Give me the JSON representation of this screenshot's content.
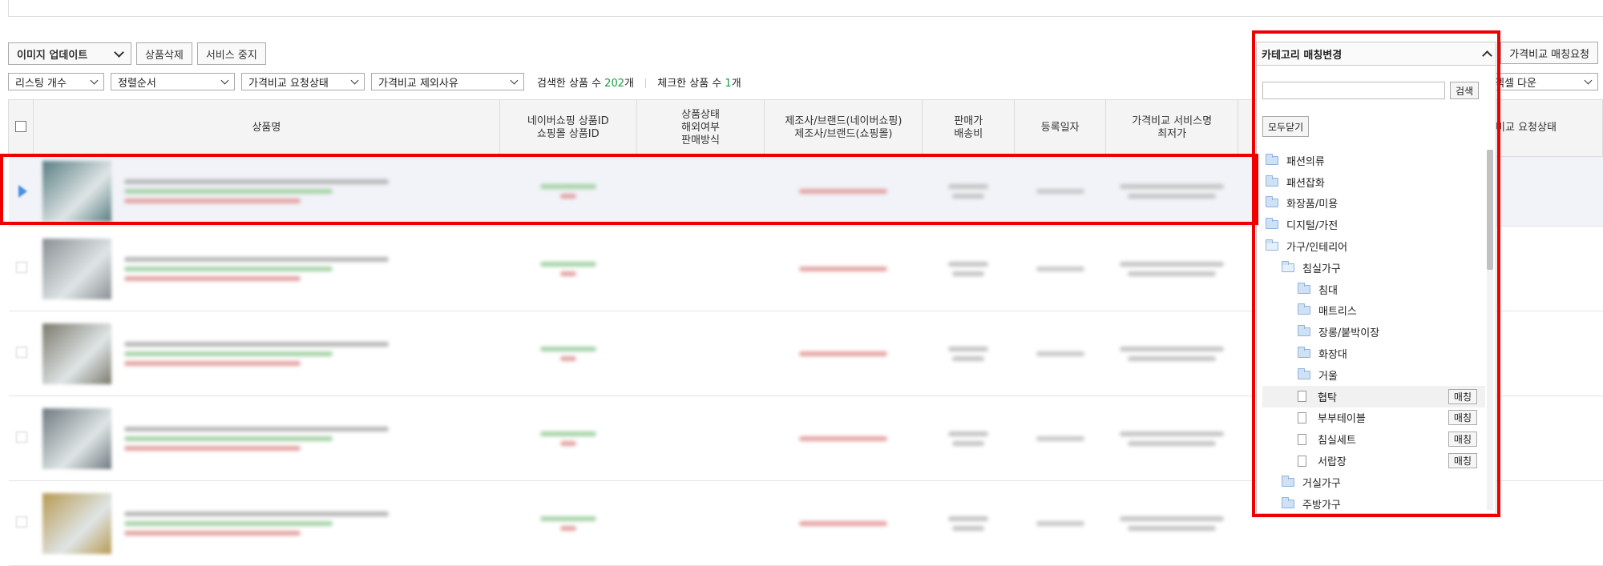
{
  "toolbar": {
    "image_update": "이미지 업데이트",
    "delete_product": "상품삭제",
    "stop_service": "서비스 중지",
    "price_match_request": "가격비교 매칭요청"
  },
  "filters": {
    "listing_count": "리스팅 개수",
    "sort_order": "정렬순서",
    "request_status": "가격비교 요청상태",
    "exclude_reason": "가격비교 제외사유",
    "searched_label": "검색한 상품 수",
    "searched_count": "202",
    "checked_label": "체크한 상품 수",
    "checked_count": "1",
    "unit": "개",
    "download": "엑셀 다운"
  },
  "table": {
    "headers": {
      "name": "상품명",
      "ids": [
        "네이버쇼핑 상품ID",
        "쇼핑몰 상품ID"
      ],
      "status": [
        "상품상태",
        "해외여부",
        "판매방식"
      ],
      "brand": [
        "제조사/브랜드(네이버쇼핑)",
        "제조사/브랜드(쇼핑몰)"
      ],
      "price": [
        "판매가",
        "배송비"
      ],
      "date": "등록일자",
      "service": [
        "가격비교 서비스명",
        "최저가"
      ],
      "req_status": "가격비교 요청상태"
    },
    "row_count": 5
  },
  "category_panel": {
    "title": "카테고리 매칭변경",
    "search_button": "검색",
    "search_placeholder": "",
    "collapse_all": "모두닫기",
    "match_label": "매칭",
    "items": [
      {
        "label": "패션의류",
        "type": "folder",
        "level": 0
      },
      {
        "label": "패션잡화",
        "type": "folder",
        "level": 0
      },
      {
        "label": "화장품/미용",
        "type": "folder",
        "level": 0
      },
      {
        "label": "디지털/가전",
        "type": "folder",
        "level": 0
      },
      {
        "label": "가구/인테리어",
        "type": "folder-open",
        "level": 0
      },
      {
        "label": "침실가구",
        "type": "folder-open",
        "level": 1
      },
      {
        "label": "침대",
        "type": "folder",
        "level": 2
      },
      {
        "label": "매트리스",
        "type": "folder",
        "level": 2
      },
      {
        "label": "장롱/붙박이장",
        "type": "folder",
        "level": 2
      },
      {
        "label": "화장대",
        "type": "folder",
        "level": 2
      },
      {
        "label": "거울",
        "type": "folder",
        "level": 2
      },
      {
        "label": "협탁",
        "type": "leaf",
        "level": 2
      },
      {
        "label": "부부테이블",
        "type": "leaf",
        "level": 2
      },
      {
        "label": "침실세트",
        "type": "leaf",
        "level": 2
      },
      {
        "label": "서랍장",
        "type": "leaf",
        "level": 2
      },
      {
        "label": "거실가구",
        "type": "folder",
        "level": 1
      },
      {
        "label": "주방가구",
        "type": "folder",
        "level": 1
      }
    ]
  },
  "colors": {
    "highlight_border": "#ee0000",
    "count_green": "#1a9c3e",
    "row_highlight": "#f1f3f8"
  }
}
